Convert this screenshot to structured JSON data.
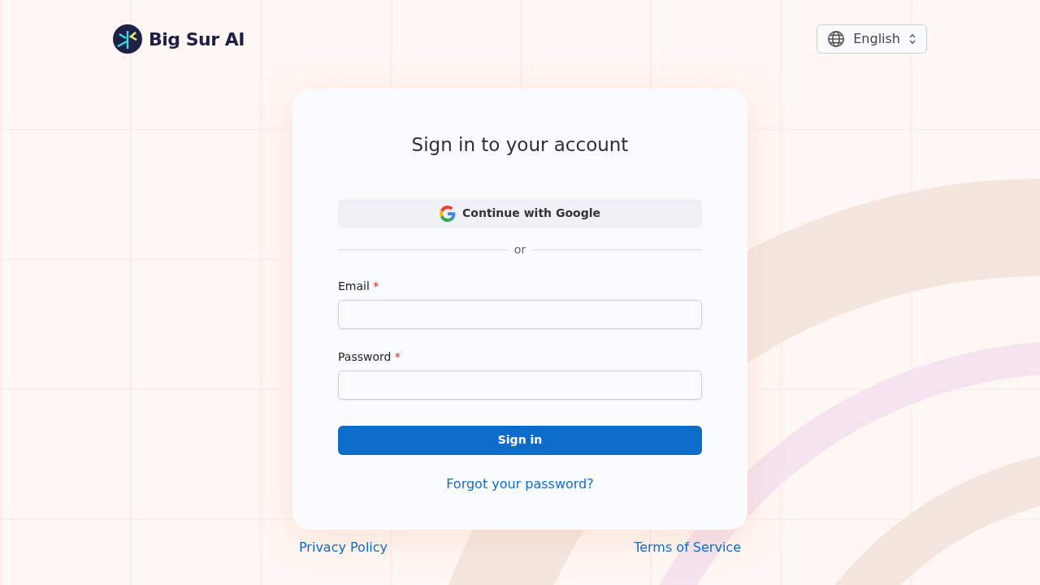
{
  "brand": {
    "name": "Big Sur AI"
  },
  "language_selector": {
    "value": "English"
  },
  "card": {
    "title": "Sign in to your account",
    "google_button": "Continue with Google",
    "divider_text": "or",
    "fields": [
      {
        "label": "Email",
        "required_mark": "*"
      },
      {
        "label": "Password",
        "required_mark": "*"
      }
    ],
    "submit_button": "Sign in",
    "forgot_link": "Forgot your password?"
  },
  "footer_links": [
    "Privacy Policy",
    "Terms of Service"
  ]
}
